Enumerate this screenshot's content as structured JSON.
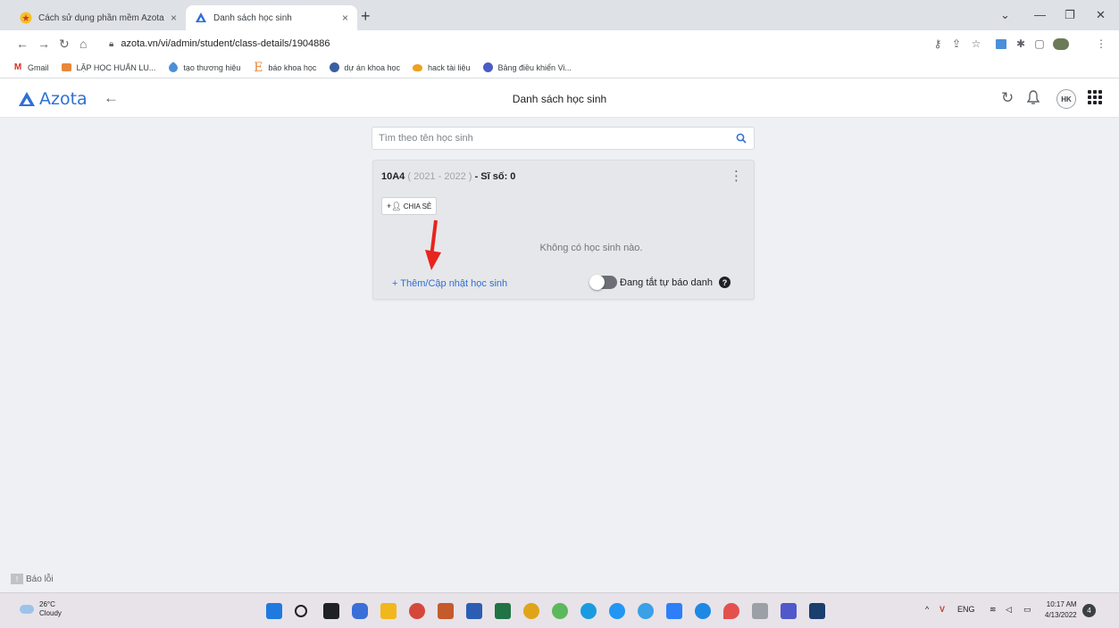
{
  "browser": {
    "tabs": [
      {
        "title": "Cách sử dụng phần mềm Azota",
        "close": "×"
      },
      {
        "title": "Danh sách học sinh",
        "close": "×"
      }
    ],
    "new_tab": "+",
    "url": "azota.vn/vi/admin/student/class-details/1904886"
  },
  "bookmarks": [
    {
      "label": "Gmail",
      "icon": "gmail-icon"
    },
    {
      "label": "LẬP HỌC HUẤN LU...",
      "icon": "folder-icon"
    },
    {
      "label": "tạo thương hiệu",
      "icon": "tag-icon"
    },
    {
      "label": "báo khoa học",
      "icon": "letter-e-icon"
    },
    {
      "label": "dự án khoa học",
      "icon": "globe-icon"
    },
    {
      "label": "hack tài liệu",
      "icon": "bird-icon"
    },
    {
      "label": "Bảng điều khiển Vi...",
      "icon": "dashboard-icon"
    }
  ],
  "app": {
    "logo_text": "Azota",
    "page_title": "Danh sách học sinh",
    "avatar": "HK"
  },
  "search": {
    "placeholder": "Tìm theo tên học sinh"
  },
  "class_card": {
    "class_name": "10A4",
    "year": "( 2021 - 2022 )",
    "count_label": "- Sĩ số: 0",
    "share_label": "CHIA SẺ",
    "empty_text": "Không có học sinh nào.",
    "add_link": "+ Thêm/Cập nhật học sinh",
    "toggle_label": "Đang tắt tự báo danh",
    "help": "?"
  },
  "bug_report": "Báo lỗi",
  "taskbar": {
    "temp": "26°C",
    "condition": "Cloudy",
    "lang": "ENG",
    "time": "10:17 AM",
    "date": "4/13/2022",
    "notifications": "4"
  },
  "colors": {
    "accent": "#2f6fd6",
    "annotation_arrow": "#e8241f"
  }
}
